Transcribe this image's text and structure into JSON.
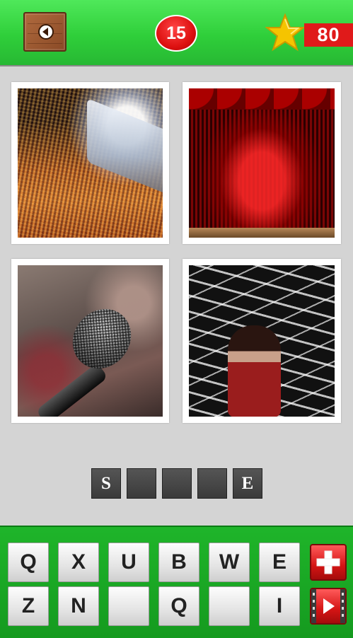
{
  "header": {
    "back_icon": "back-arrow-icon",
    "level": "15",
    "star_icon": "star-icon",
    "coins": "80"
  },
  "puzzle": {
    "pictures": [
      {
        "subject": "concert crowd"
      },
      {
        "subject": "red stage curtain"
      },
      {
        "subject": "microphone"
      },
      {
        "subject": "singer on stage"
      }
    ]
  },
  "answer": {
    "slots": [
      "S",
      "",
      "",
      "",
      "E"
    ]
  },
  "keyboard": {
    "row1": [
      "Q",
      "X",
      "U",
      "B",
      "W",
      "E"
    ],
    "row2": [
      "Z",
      "N",
      "",
      "Q",
      "",
      "I"
    ],
    "hint_icon": "plus-icon",
    "video_icon": "play-film-icon"
  },
  "colors": {
    "header_green": "#2fcf3a",
    "badge_red": "#dd1111",
    "keyboard_green": "#1fb52a",
    "slot_dark": "#444444",
    "star_gold": "#f5c400"
  }
}
